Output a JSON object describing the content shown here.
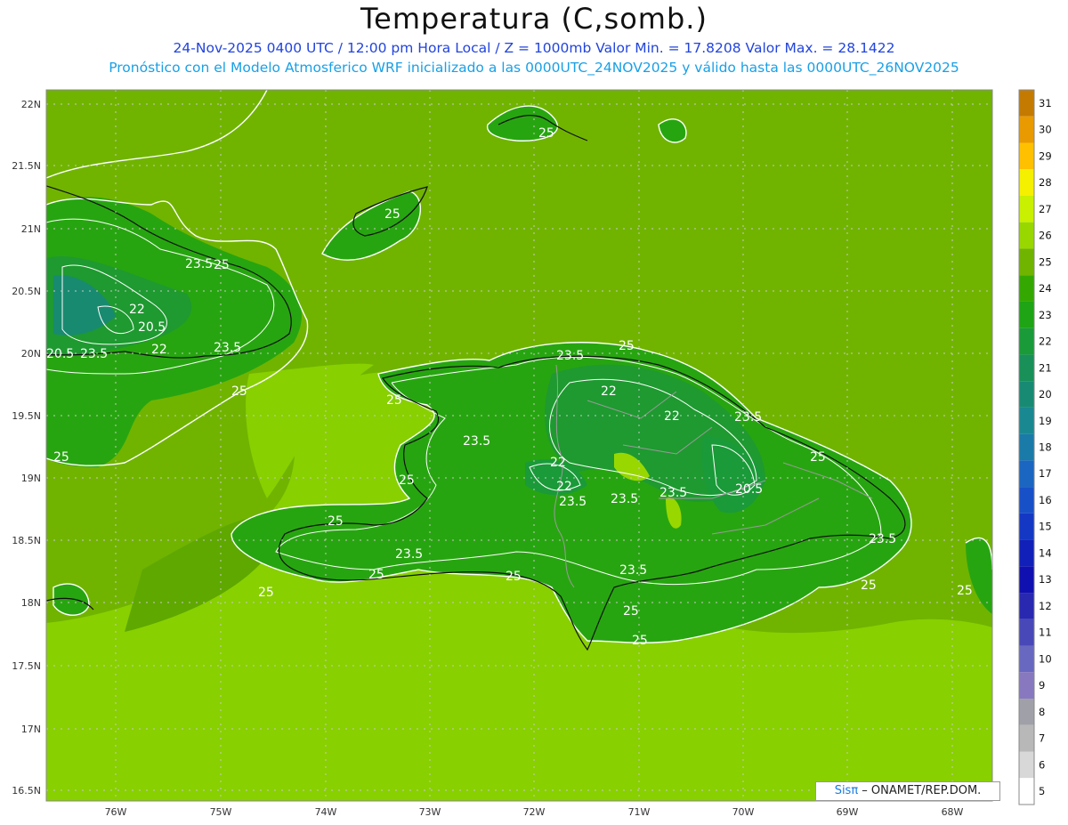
{
  "header": {
    "title": "Temperatura (C,somb.)",
    "line1": "24-Nov-2025 0400 UTC / 12:00 pm Hora Local / Z = 1000mb  Valor Min. = 17.8208  Valor Max. = 28.1422",
    "line2": "Pronóstico con el Modelo Atmosferico WRF inicializado a las 0000UTC_24NOV2025 y válido hasta las  0000UTC_26NOV2025"
  },
  "axes": {
    "lat_labels": [
      "22N",
      "21.5N",
      "21N",
      "20.5N",
      "20N",
      "19.5N",
      "19N",
      "18.5N",
      "18N",
      "17.5N",
      "17N",
      "16.5N"
    ],
    "lon_labels": [
      "76W",
      "75W",
      "74W",
      "73W",
      "72W",
      "71W",
      "70W",
      "69W",
      "68W"
    ]
  },
  "colorbar": {
    "levels": [
      "31",
      "30",
      "29",
      "28",
      "27",
      "26",
      "25",
      "24",
      "23",
      "22",
      "21",
      "20",
      "19",
      "18",
      "17",
      "16",
      "15",
      "14",
      "13",
      "12",
      "11",
      "10",
      "9",
      "8",
      "7",
      "6",
      "5"
    ],
    "colors": [
      "#c47a00",
      "#e89a00",
      "#ffc000",
      "#f5ef00",
      "#c8f000",
      "#98d800",
      "#70b400",
      "#34a800",
      "#1ea414",
      "#1a9a38",
      "#189058",
      "#188a74",
      "#1a8890",
      "#1a7aa8",
      "#1a66c0",
      "#1850c8",
      "#1438c4",
      "#1020b8",
      "#1010b0",
      "#2828b0",
      "#4848b8",
      "#6868c0",
      "#8878c0",
      "#a0a0a8",
      "#b8b8b8",
      "#d8d8d8",
      "#ffffff"
    ]
  },
  "contour_labels": [
    "25",
    "25",
    "23.5",
    "25",
    "22",
    "20.5",
    "22",
    "23.5",
    "20.5",
    "23.5",
    "25",
    "25",
    "25",
    "25",
    "23.5",
    "22",
    "22",
    "23.5",
    "22",
    "23.5",
    "23.5",
    "25",
    "25",
    "23.5",
    "25",
    "23.5",
    "23.5",
    "20.5",
    "23.5",
    "25",
    "25",
    "23.5",
    "25",
    "25",
    "25",
    "25",
    "22",
    "25"
  ],
  "credit": {
    "brand": "Sisπ",
    "text": " – ONAMET/REP.DOM."
  }
}
